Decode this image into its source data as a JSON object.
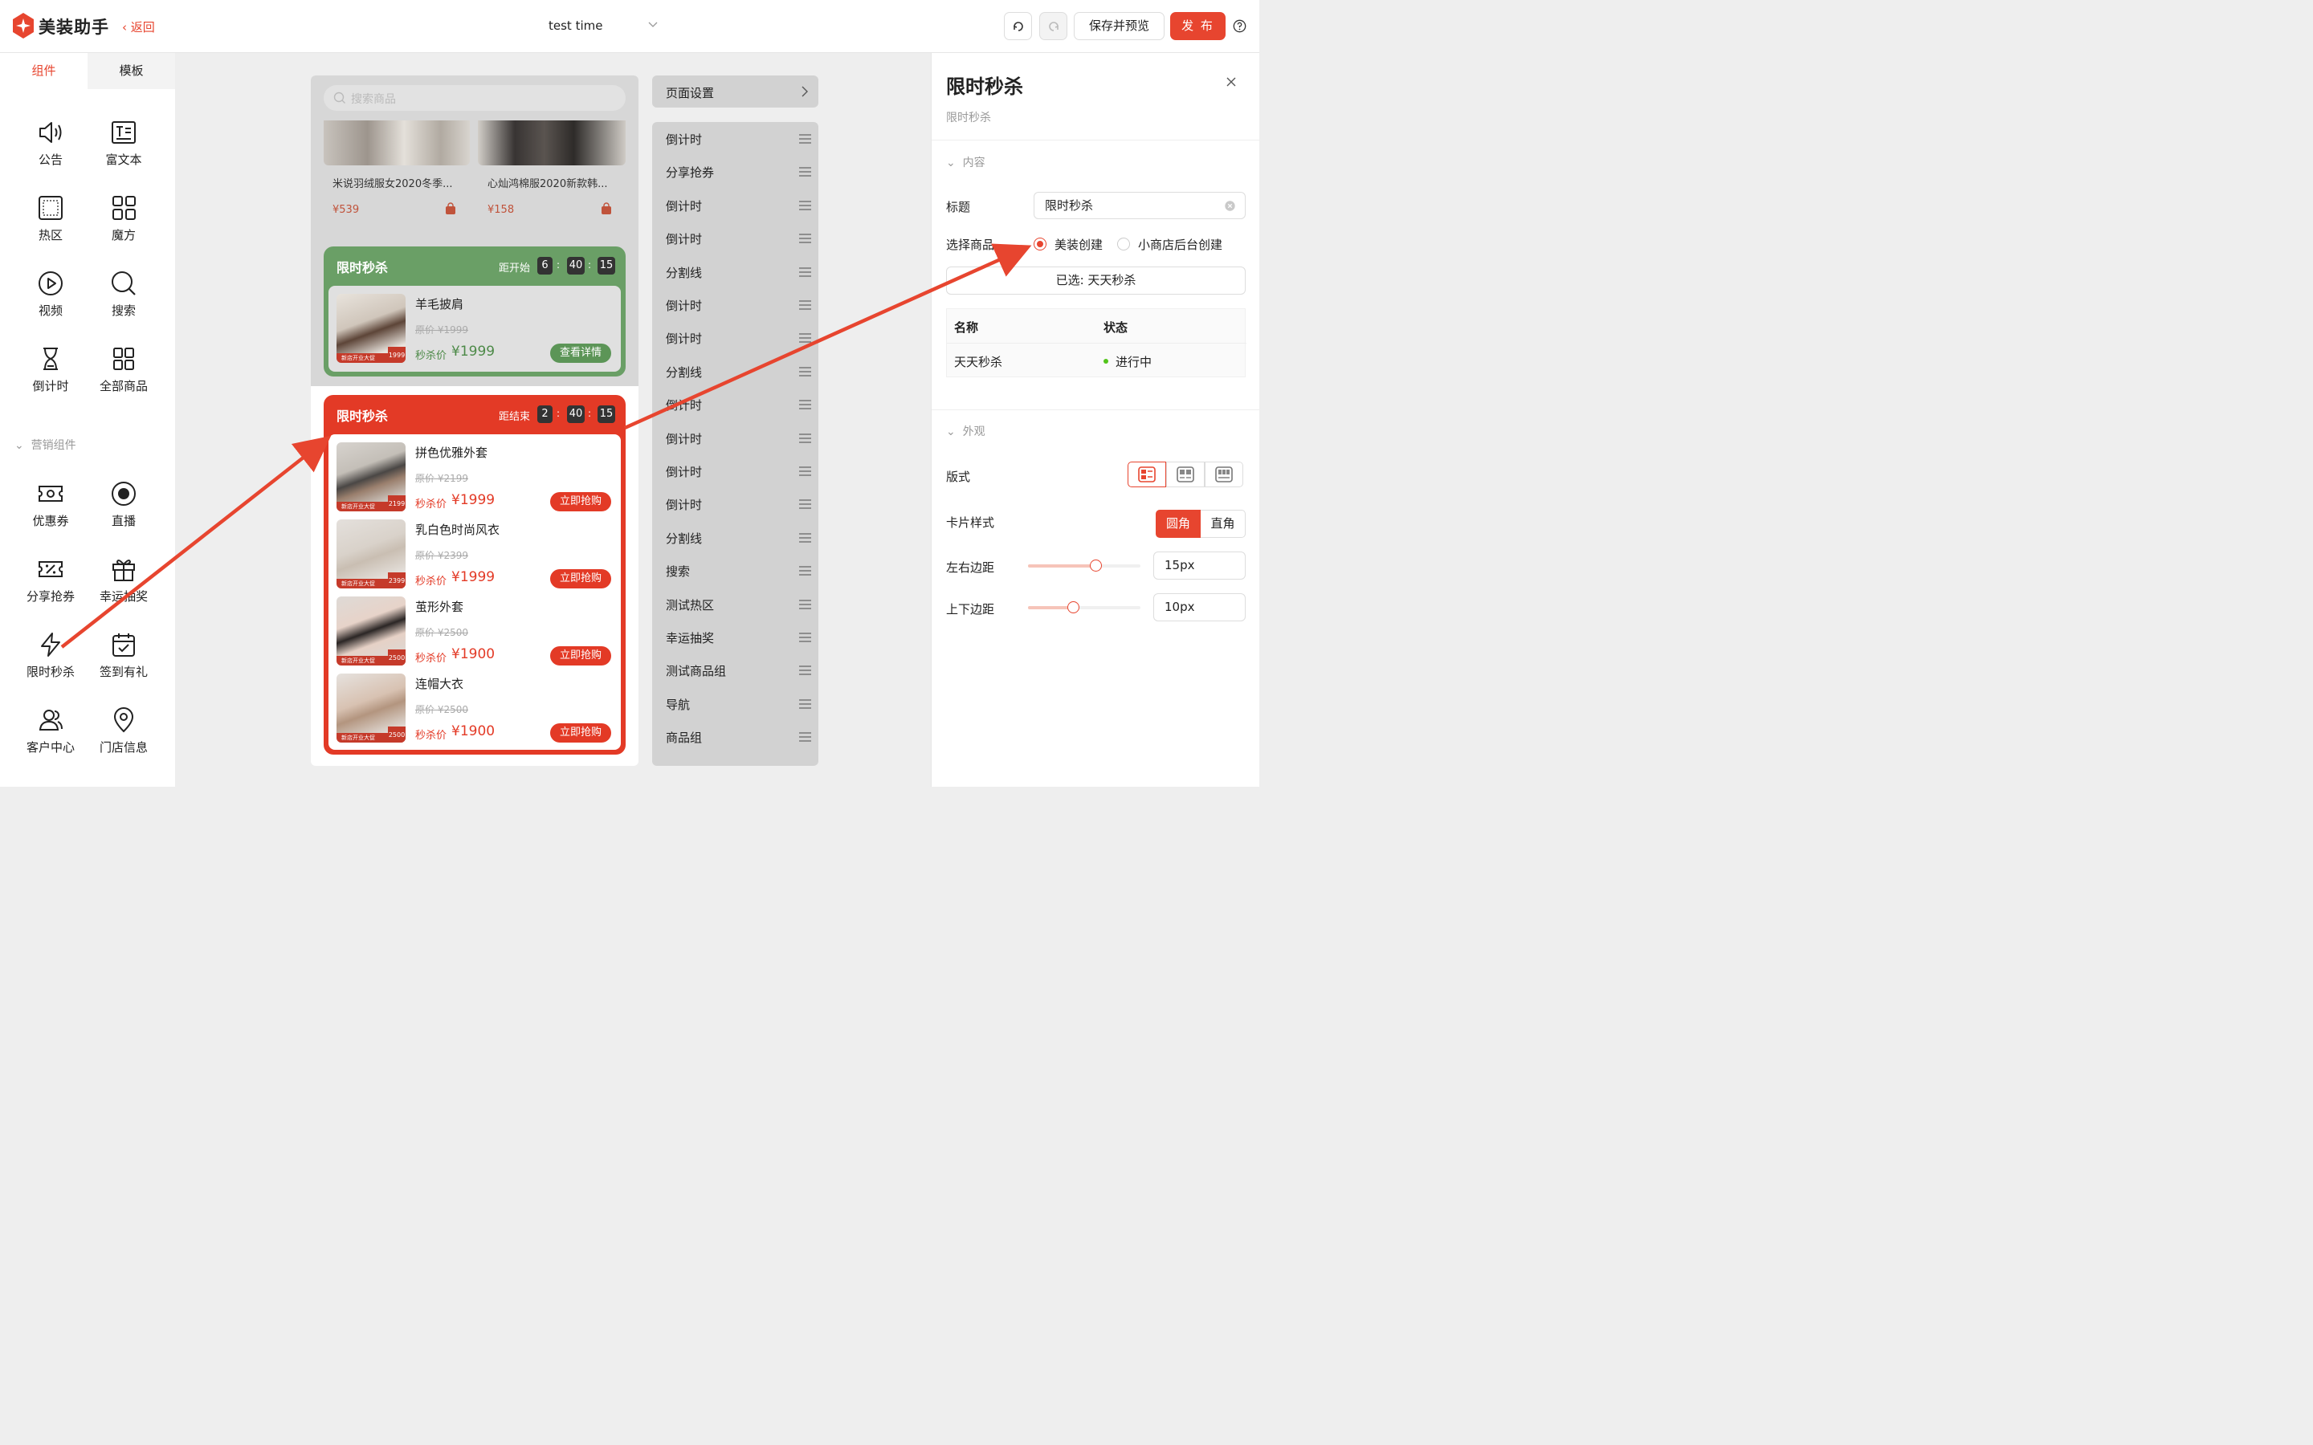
{
  "header": {
    "app_title": "美装助手",
    "back_label": "返回",
    "doc_title": "test time",
    "save_preview_label": "保存并预览",
    "publish_label": "发 布",
    "accent": "#e7452f"
  },
  "left_panel": {
    "tabs": [
      {
        "label": "组件",
        "active": true
      },
      {
        "label": "模板",
        "active": false
      }
    ],
    "basic_components": [
      {
        "label": "公告",
        "icon": "speaker-icon"
      },
      {
        "label": "富文本",
        "icon": "rich-text-icon"
      },
      {
        "label": "热区",
        "icon": "hotspot-icon"
      },
      {
        "label": "魔方",
        "icon": "cube-grid-icon"
      },
      {
        "label": "视频",
        "icon": "video-icon"
      },
      {
        "label": "搜索",
        "icon": "search-icon"
      },
      {
        "label": "倒计时",
        "icon": "hourglass-icon"
      },
      {
        "label": "全部商品",
        "icon": "all-goods-icon"
      }
    ],
    "marketing_section_label": "营销组件",
    "marketing_components": [
      {
        "label": "优惠券",
        "icon": "coupon-icon"
      },
      {
        "label": "直播",
        "icon": "live-icon"
      },
      {
        "label": "分享抢券",
        "icon": "share-coupon-icon"
      },
      {
        "label": "幸运抽奖",
        "icon": "gift-icon"
      },
      {
        "label": "限时秒杀",
        "icon": "lightning-icon"
      },
      {
        "label": "签到有礼",
        "icon": "calendar-check-icon"
      },
      {
        "label": "客户中心",
        "icon": "users-icon"
      },
      {
        "label": "门店信息",
        "icon": "location-icon"
      }
    ]
  },
  "canvas": {
    "search_placeholder": "搜索商品",
    "top_products": [
      {
        "name": "米说羽绒服女2020冬季...",
        "price": "¥539"
      },
      {
        "name": "心灿鸿棉服2020新款韩...",
        "price": "¥158"
      }
    ],
    "green_block": {
      "title": "限时秒杀",
      "countdown_label": "距开始",
      "countdown": [
        "6",
        "40",
        "15"
      ],
      "item": {
        "name": "羊毛披肩",
        "orig": "原价 ¥1999",
        "sale_label": "秒杀价",
        "sale": "¥1999",
        "button": "查看详情",
        "band": "新店开业大促",
        "tag": "1999"
      }
    },
    "red_block": {
      "title": "限时秒杀",
      "countdown_label": "距结束",
      "countdown": [
        "2",
        "40",
        "15"
      ],
      "items": [
        {
          "name": "拼色优雅外套",
          "orig": "原价 ¥2199",
          "sale_label": "秒杀价",
          "sale": "¥1999",
          "button": "立即抢购",
          "band": "新店开业大促",
          "tag": "2199"
        },
        {
          "name": "乳白色时尚风衣",
          "orig": "原价 ¥2399",
          "sale_label": "秒杀价",
          "sale": "¥1999",
          "button": "立即抢购",
          "band": "新店开业大促",
          "tag": "2399"
        },
        {
          "name": "茧形外套",
          "orig": "原价 ¥2500",
          "sale_label": "秒杀价",
          "sale": "¥1900",
          "button": "立即抢购",
          "band": "新店开业大促",
          "tag": "2500"
        },
        {
          "name": "连帽大衣",
          "orig": "原价 ¥2500",
          "sale_label": "秒杀价",
          "sale": "¥1900",
          "button": "立即抢购",
          "band": "新店开业大促",
          "tag": "2500"
        }
      ]
    }
  },
  "component_list": {
    "page_settings_label": "页面设置",
    "items": [
      "倒计时",
      "分享抢券",
      "倒计时",
      "倒计时",
      "分割线",
      "倒计时",
      "倒计时",
      "分割线",
      "倒计时",
      "倒计时",
      "倒计时",
      "倒计时",
      "分割线",
      "搜索",
      "测试热区",
      "幸运抽奖",
      "测试商品组",
      "导航",
      "商品组"
    ]
  },
  "right_panel": {
    "title": "限时秒杀",
    "subtitle": "限时秒杀",
    "content_section": "内容",
    "title_field_label": "标题",
    "title_field_value": "限时秒杀",
    "select_goods_label": "选择商品",
    "radio_options": [
      {
        "label": "美装创建",
        "checked": true
      },
      {
        "label": "小商店后台创建",
        "checked": false
      }
    ],
    "selected_button": "已选: 天天秒杀",
    "table": {
      "headers": [
        "名称",
        "状态"
      ],
      "rows": [
        {
          "name": "天天秒杀",
          "status": "进行中"
        }
      ]
    },
    "appearance_section": "外观",
    "layout_label": "版式",
    "card_style_label": "卡片样式",
    "card_style_options": [
      {
        "label": "圆角",
        "active": true
      },
      {
        "label": "直角",
        "active": false
      }
    ],
    "h_margin_label": "左右边距",
    "h_margin_value": "15px",
    "v_margin_label": "上下边距",
    "v_margin_value": "10px",
    "h_margin_fraction": 0.6,
    "v_margin_fraction": 0.4
  }
}
